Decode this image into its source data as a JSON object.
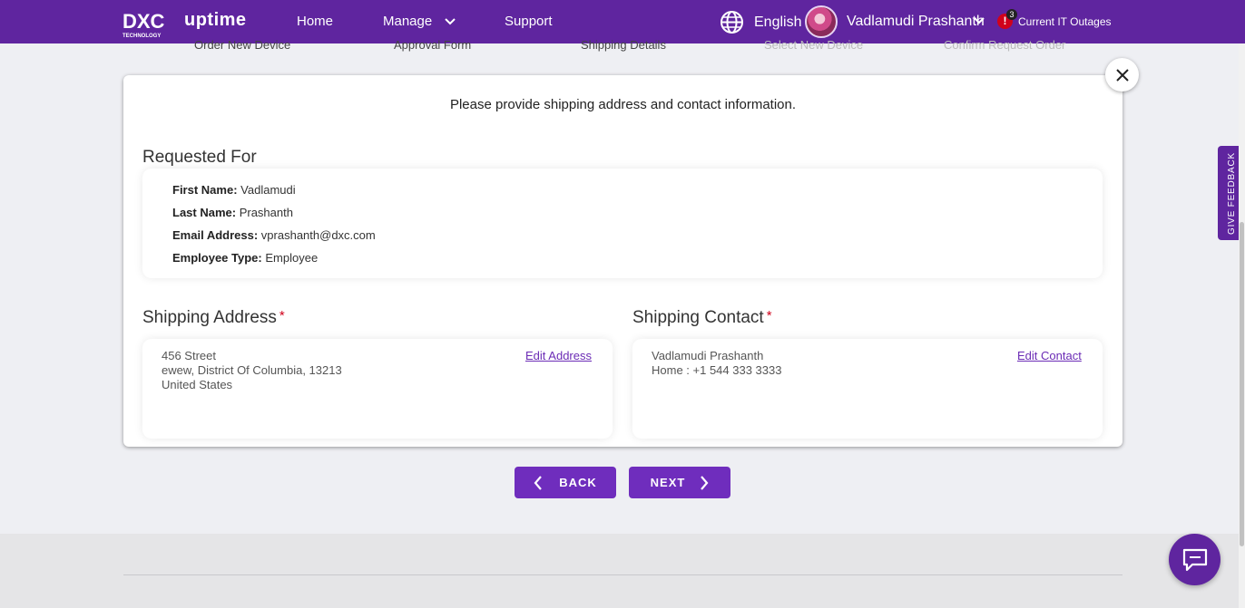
{
  "header": {
    "brand_sub": "TECHNOLOGY",
    "app_name": "uptime",
    "nav": {
      "home": "Home",
      "manage": "Manage",
      "support": "Support"
    },
    "language": "English",
    "user_name": "Vadlamudi Prashanth",
    "alert_count": "3",
    "alert_symbol": "!",
    "outages_label": "Current IT Outages"
  },
  "stepper": [
    "Order New Device",
    "Approval Form",
    "Shipping Details",
    "Select New Device",
    "Confirm Request Order"
  ],
  "card": {
    "instruction": "Please provide shipping address and contact information.",
    "requested_for": {
      "title": "Requested For",
      "first_name_label": "First Name:",
      "first_name": "Vadlamudi",
      "last_name_label": "Last Name:",
      "last_name": "Prashanth",
      "email_label": "Email Address:",
      "email": "vprashanth@dxc.com",
      "employee_type_label": "Employee Type:",
      "employee_type": "Employee"
    },
    "shipping_address": {
      "title": "Shipping Address",
      "required_mark": "*",
      "lines": [
        "456 Street",
        "ewew, District Of Columbia, 13213",
        "United States"
      ],
      "edit_label": "Edit Address"
    },
    "shipping_contact": {
      "title": "Shipping Contact",
      "required_mark": "*",
      "name": "Vadlamudi Prashanth",
      "phone": "Home : +1 544 333 3333",
      "edit_label": "Edit Contact"
    }
  },
  "buttons": {
    "back": "BACK",
    "next": "NEXT"
  },
  "feedback_label": "GIVE FEEDBACK",
  "colors": {
    "brand": "#5f259f",
    "button": "#6f2dbd",
    "required": "#d0021b",
    "link": "#6b2bb5",
    "alert": "#d0021b"
  }
}
